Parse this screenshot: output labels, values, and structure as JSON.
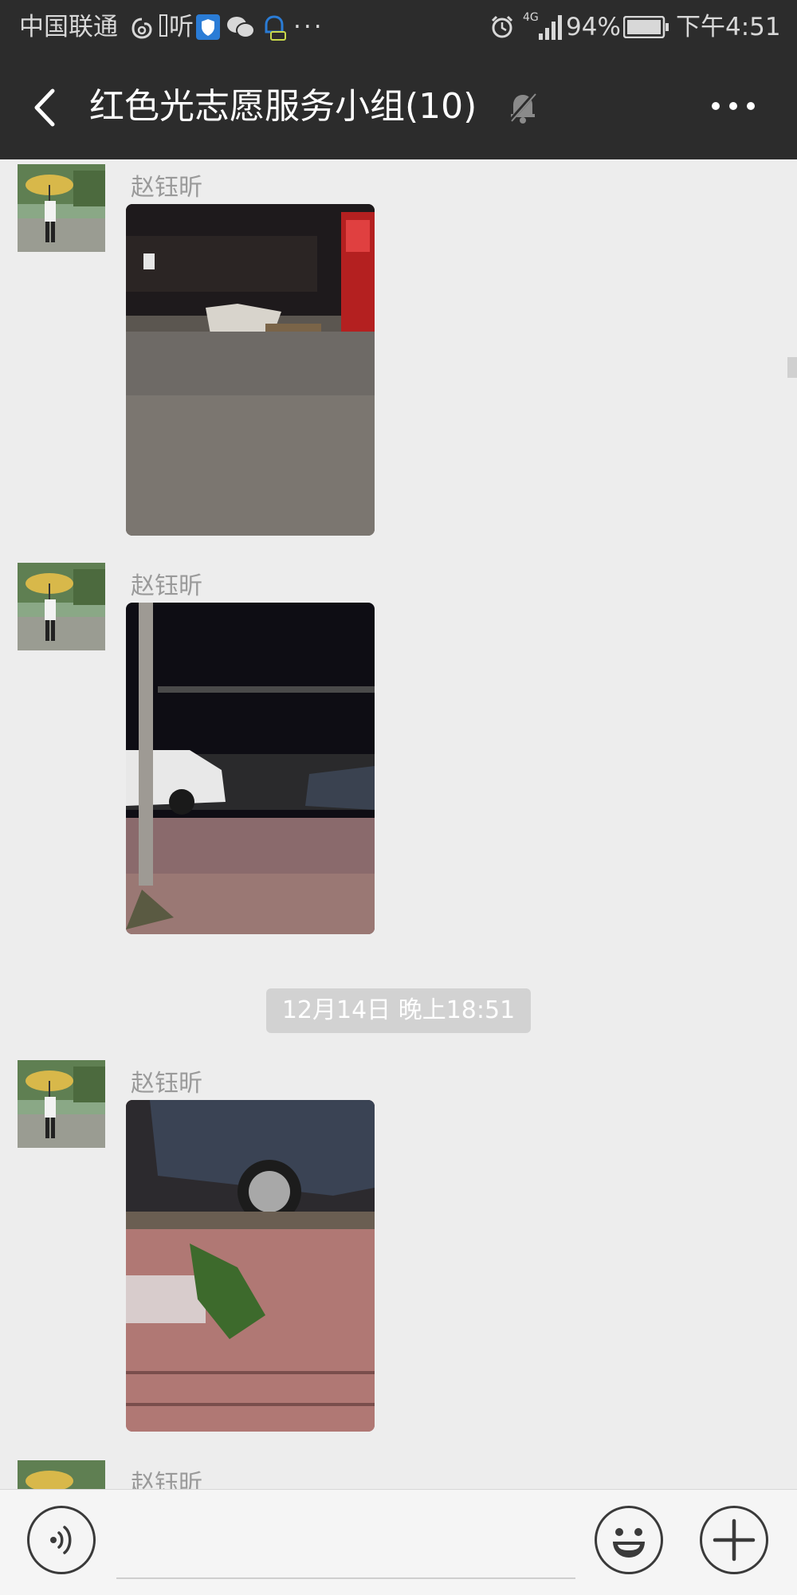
{
  "status_bar": {
    "carrier": "中国联通",
    "listen_label": "听",
    "network": "4G",
    "battery": "94%",
    "time": "下午4:51"
  },
  "header": {
    "title": "红色光志愿服务小组(10)",
    "icons": [
      "back-icon",
      "mute-bell-icon",
      "more-options-icon"
    ]
  },
  "messages": [
    {
      "sender": "赵钰昕",
      "type": "image"
    },
    {
      "sender": "赵钰昕",
      "type": "image"
    },
    {
      "timestamp": "12月14日 晚上18:51"
    },
    {
      "sender": "赵钰昕",
      "type": "image"
    },
    {
      "sender": "赵钰昕",
      "type": "image"
    }
  ],
  "input_bar": {
    "icons": [
      "voice-icon",
      "emoji-icon",
      "plus-icon"
    ],
    "text_value": ""
  }
}
